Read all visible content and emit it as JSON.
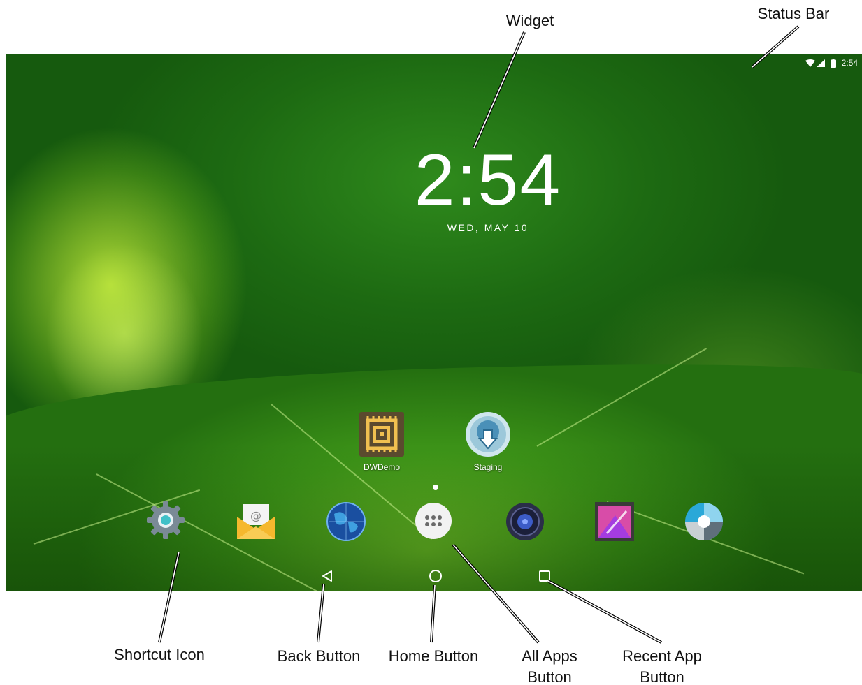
{
  "status_bar": {
    "time": "2:54"
  },
  "clock_widget": {
    "time": "2:54",
    "date": "WED, MAY 10"
  },
  "apps": [
    {
      "label": "DWDemo",
      "icon": "dwdemo-icon"
    },
    {
      "label": "Staging",
      "icon": "staging-icon"
    }
  ],
  "dock": [
    {
      "icon": "settings-icon"
    },
    {
      "icon": "email-icon"
    },
    {
      "icon": "browser-globe-icon"
    },
    {
      "icon": "all-apps-icon"
    },
    {
      "icon": "music-speaker-icon"
    },
    {
      "icon": "gallery-icon"
    },
    {
      "icon": "camera-icon"
    }
  ],
  "nav": [
    {
      "icon": "back-icon"
    },
    {
      "icon": "home-icon"
    },
    {
      "icon": "recents-icon"
    }
  ],
  "callouts": {
    "widget": "Widget",
    "status_bar": "Status Bar",
    "shortcut_icon": "Shortcut Icon",
    "back_button": "Back Button",
    "home_button": "Home Button",
    "all_apps_line1": "All Apps",
    "all_apps_line2": "Button",
    "recent_app_line1": "Recent App",
    "recent_app_line2": "Button"
  },
  "colors": {
    "wallpaper_dark": "#1d6a12",
    "leaf": "#6fbf28",
    "text_on_screen": "#ffffff"
  }
}
